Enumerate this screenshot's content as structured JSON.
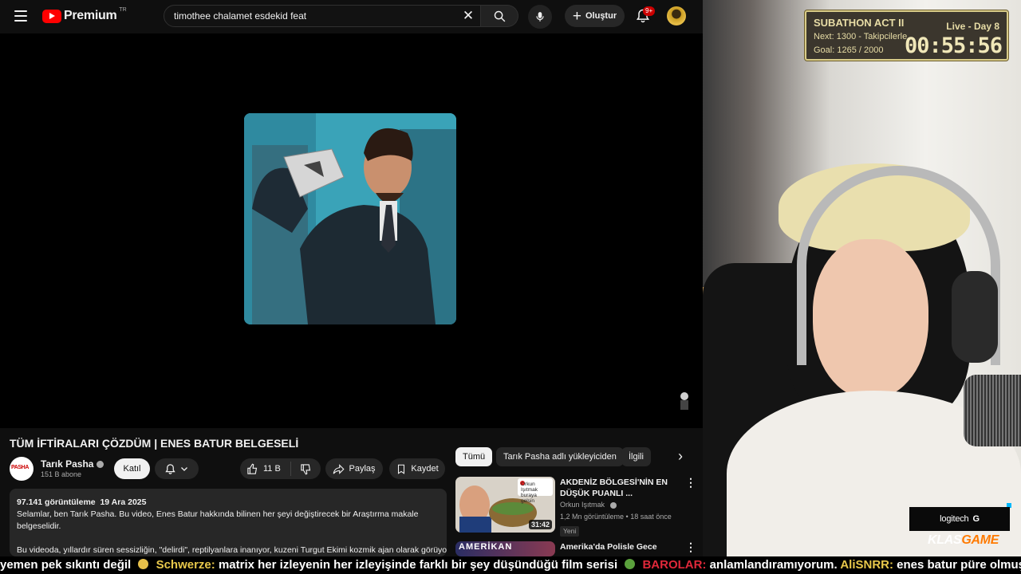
{
  "youtube": {
    "logo_text": "Premium",
    "logo_region": "TR",
    "search": {
      "value": "timothee chalamet esdekid feat"
    },
    "create_label": "Oluştur",
    "notifications_badge": "9+"
  },
  "video": {
    "title": "TÜM İFTİRALARI ÇÖZDÜM | ENES BATUR BELGESELİ",
    "channel": {
      "name": "Tarık Pasha",
      "subscribers": "151 B abone",
      "join_label": "Katıl"
    },
    "likes": "11 B",
    "share_label": "Paylaş",
    "save_label": "Kaydet",
    "description": {
      "views": "97.141 görüntüleme",
      "date": "19 Ara 2025",
      "line1": "Selamlar, ben Tarık Pasha. Bu video, Enes Batur hakkında bilinen her şeyi değiştirecek bir Araştırma makale belgeselidir.",
      "line2": "Bu videoda, yıllardır süren sessizliğin, \"delirdi\", reptilyanlara inanıyor, kuzeni Turgut Ekimi kozmik ajan olarak görüyor"
    }
  },
  "chips": [
    "Tümü",
    "Tarık Pasha adlı yükleyiciden",
    "İlgili"
  ],
  "recommendations": [
    {
      "title": "AKDENİZ BÖLGESİ'NİN EN DÜŞÜK PUANLI ...",
      "channel": "Orkun Işıtmak",
      "views": "1,2 Mn görüntüleme",
      "age": "18 saat önce",
      "badge": "Yeni",
      "duration": "31:42",
      "thumb_caption": "Orkun Işıtmak buraya gelsin"
    },
    {
      "title": "Amerika'da Polisle Gece",
      "thumb_caption": "AMERİKAN"
    }
  ],
  "overlay": {
    "subathon": {
      "title": "SUBATHON ACT II",
      "day": "Live - Day 8",
      "next": "Next: 1300 - Takipcilerle",
      "goal": "Goal: 1265 / 2000",
      "timer": "00:55:56"
    },
    "sponsor": "logitech",
    "brand_prefix": "KLAS",
    "brand_suffix": "GAME"
  },
  "ticker": {
    "seg1": "yemen pek sıkıntı değil",
    "user2": "Schwerze:",
    "msg2": "matrix her izleyenin her izleyişinde farklı bir şey düşündüğü film serisi",
    "user3": "BAROLAR:",
    "msg3": "anlamlandıramıyorum.",
    "user4": "AliSNRR:",
    "msg4": "enes batur püre olmuş"
  },
  "colors": {
    "youtube_red": "#ff0000",
    "subathon_border": "#d8cb88",
    "ticker_user": "#e8c84b",
    "ticker_user_alt": "#e0283a"
  }
}
